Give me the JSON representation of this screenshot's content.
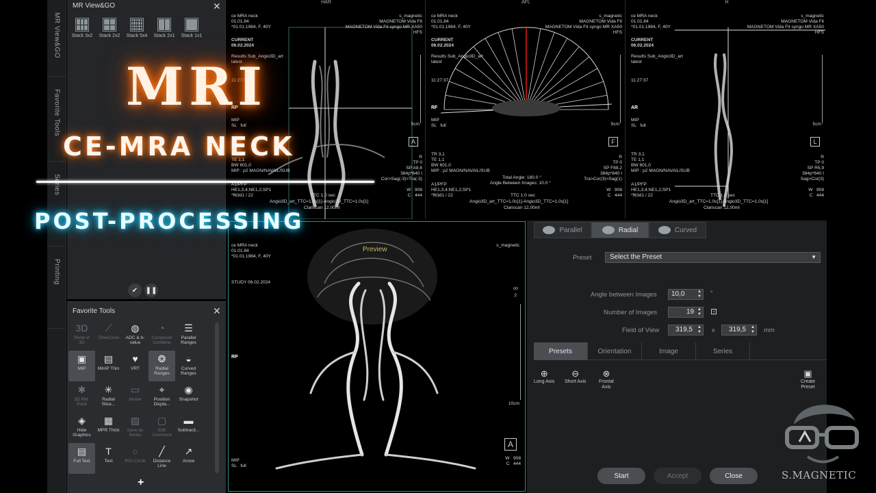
{
  "side_tabs": [
    "MR View&GO",
    "Favorite Tools",
    "Series",
    "Printing"
  ],
  "mr_panel": {
    "title": "MR View&GO",
    "stacks": [
      {
        "label": "Stack 3x2",
        "cols": 3,
        "rows": 2
      },
      {
        "label": "Stack 2x2",
        "cols": 2,
        "rows": 2
      },
      {
        "label": "Stack 5x4",
        "cols": 5,
        "rows": 4
      },
      {
        "label": "Stack 2x1",
        "cols": 2,
        "rows": 1
      },
      {
        "label": "Stack 1x1",
        "cols": 1,
        "rows": 1
      }
    ]
  },
  "favorites": {
    "title": "Favorite Tools",
    "tools": [
      {
        "label": "Show in\n3D",
        "icon": "3D",
        "dim": true
      },
      {
        "label": "TimeCurve",
        "icon": "⟋",
        "dim": true
      },
      {
        "label": "ADC & b-\nvalue",
        "icon": "◍",
        "dim": false
      },
      {
        "label": "Composer\nCombine",
        "icon": "◔",
        "dim": true
      },
      {
        "label": "Parallel\nRanges",
        "icon": "☰",
        "dim": false
      },
      {
        "label": "MIP",
        "icon": "▣",
        "dim": false,
        "selected": true
      },
      {
        "label": "MinIP Thin",
        "icon": "▤",
        "dim": false
      },
      {
        "label": "VRT",
        "icon": "♥",
        "dim": false
      },
      {
        "label": "Radial\nRanges",
        "icon": "❂",
        "dim": false,
        "selected": true
      },
      {
        "label": "Curved\nRanges",
        "icon": "◒",
        "dim": false
      },
      {
        "label": "3D Ref.\nPoint",
        "icon": "✱",
        "dim": true
      },
      {
        "label": "Radial\nSlice...",
        "icon": "✳",
        "dim": false
      },
      {
        "label": "Movie",
        "icon": "▭",
        "dim": true
      },
      {
        "label": "Position\nDispla...",
        "icon": "⌖",
        "dim": false
      },
      {
        "label": "Snapshot",
        "icon": "◉",
        "dim": false
      },
      {
        "label": "Hide\nGraphics",
        "icon": "◈",
        "dim": false
      },
      {
        "label": "MPR Thick",
        "icon": "▦",
        "dim": false
      },
      {
        "label": "Save as\nSeries",
        "icon": "▧",
        "dim": true
      },
      {
        "label": "Edit\nComment",
        "icon": "▢",
        "dim": true
      },
      {
        "label": "Subtracti...",
        "icon": "▬",
        "dim": false
      },
      {
        "label": "Full Text",
        "icon": "▤",
        "dim": false,
        "selected": true
      },
      {
        "label": "Text",
        "icon": "T",
        "dim": false
      },
      {
        "label": "ROI Circle",
        "icon": "○",
        "dim": true
      },
      {
        "label": "Distance\nLine",
        "icon": "╱",
        "dim": false
      },
      {
        "label": "Arrow",
        "icon": "↗",
        "dim": false
      }
    ]
  },
  "viewports": {
    "har": {
      "header": "HAR",
      "name": "ce MRA neck",
      "date": "01.01.84",
      "patient": "*01.01.1984, F, 40Y",
      "study_label": "CURRENT",
      "study_date": "06.02.2024",
      "result": "Results Sub_Angio3D_art",
      "latest": "latest",
      "time": "11:27:37",
      "orient_left": "RP",
      "mip": "MIP",
      "sl": "SL",
      "sl_val": "full",
      "tr": "TR 3,1",
      "te": "TE 1,1",
      "bw": "BW 601,0",
      "mip2": "MIP : p2 MAGN/NAVAIL/SUB",
      "a1": "A1/PFP",
      "he": "HE1,3,4;NE1,2;SP1",
      "fov": "*f63d1 / 22",
      "site": "s_magnetic",
      "scanner1": "MAGNETOM Vida Fit",
      "scanner2": "MAGNETOM Vida Fit syngo MR XA50",
      "hfs": "HFS",
      "scale": "5cm",
      "r": "R",
      "tp": "TP 0",
      "sp": "SP A8,6",
      "matrix": "384p*640 I",
      "cor": "Cor>Sag(-3)>Tra(-3)",
      "w": "W",
      "wval": "908",
      "c": "C",
      "cval": "444",
      "ttc": "TTC 1.0 sec",
      "angio": "Angio3D_art_TTC=1.0s[1]-Angio3D_TTC=1.0s[1]",
      "clari": "Clariscan 12,00ml",
      "box": "A"
    },
    "afl": {
      "header": "AFL",
      "name": "ce MRA neck",
      "date": "01.01.84",
      "patient": "*01.01.1984, F, 40Y",
      "study_label": "CURRENT",
      "study_date": "06.02.2024",
      "result": "Results Sub_Angio3D_art",
      "latest": "latest",
      "time": "11:27:37",
      "orient_left": "RF",
      "mip": "MIP",
      "sl": "SL",
      "sl_val": "full",
      "tr": "TR 3,1",
      "te": "TE 1,1",
      "bw": "BW 601,0",
      "mip2": "MIP : p2 MAGN/NAVAIL/SUB",
      "a1": "A1/PFP",
      "he": "HE1,3,4;NE1,2;SP1",
      "fov": "*f63d1 / 22",
      "site": "s_magnetic",
      "scanner1": "MAGNETOM Vida Fit",
      "scanner2": "MAGNETOM Vida Fit syngo MR XA50",
      "hfs": "HFS",
      "scale": "5cm",
      "r": "R",
      "tp": "TP 0",
      "sp": "SP F88,2",
      "matrix": "384p*640 I",
      "cor": "Tra>Cor(3)>Sag(1)",
      "w": "W",
      "wval": "908",
      "c": "C",
      "cval": "444",
      "ttc": "TTC 1.0 sec",
      "angio": "Angio3D_art_TTC=1.0s[1]-Angio3D_TTC=1.0s[1]",
      "clari": "Clariscan 12,00ml",
      "total_angle": "Total Angle: 180.0 °",
      "between": "Angle Between Images: 10.0 °",
      "box": "F"
    },
    "h": {
      "header": "H",
      "name": "ce MRA neck",
      "date": "01.01.84",
      "patient": "*01.01.1984, F, 40Y",
      "study_label": "CURRENT",
      "study_date": "06.02.2024",
      "result": "Results Sub_Angio3D_art",
      "latest": "latest",
      "time": "11:27:37",
      "orient_left": "AR",
      "mip": "MIP",
      "sl": "SL",
      "sl_val": "full",
      "tr": "TR 3,1",
      "te": "TE 1,1",
      "bw": "BW 601,0",
      "mip2": "MIP : p2 MAGN/NAVAIL/SUB",
      "a1": "A1/PFP",
      "he": "HE1,3,4;NE1,2;SP1",
      "fov": "*f63d1 / 22",
      "site": "s_magnetic",
      "scanner1": "MAGNETOM Vida Fit",
      "scanner2": "MAGNETOM Vida Fit syngo MR XA50",
      "hfs": "HFS",
      "scale": "5cm",
      "r": "R",
      "tp": "TP 0",
      "sp": "SP R5,9",
      "matrix": "384p*640 I",
      "cor": "Sag>Cor(3)",
      "w": "W",
      "wval": "908",
      "c": "C",
      "cval": "444",
      "ttc": "TTC 1.0 sec",
      "angio": "Angio3D_art_TTC=1.0s[1]-Angio3D_TTC=1.0s[1]",
      "clari": "Clariscan 12,00ml",
      "box": "L"
    },
    "preview": {
      "name": "ce MRA neck",
      "date": "01.01.84",
      "patient": "*01.01.1984, F, 40Y",
      "study": "STUDY 06.02.2024",
      "site": "s_magnetic",
      "label": "Preview",
      "orient_left": "RP",
      "scale": "10cm",
      "mip": "MIP",
      "sl": "SL",
      "sl_val": "full",
      "w": "W",
      "wval": "908",
      "c": "C",
      "cval": "444",
      "box": "A",
      "num": "2"
    }
  },
  "protocol": {
    "tabs": [
      "Parallel",
      "Radial",
      "Curved"
    ],
    "active_tab": 1,
    "preset_label": "Preset",
    "preset_value": "Select the Preset",
    "angle_label": "Angle between Images",
    "angle_value": "10,0",
    "angle_unit": "°",
    "number_label": "Number of Images",
    "number_value": "19",
    "fov_label": "Field of View",
    "fov_w": "319,5",
    "fov_x": "x",
    "fov_h": "319,5",
    "fov_unit": "mm",
    "subtabs": [
      "Presets",
      "Orientation",
      "Image",
      "Series"
    ],
    "presets": [
      {
        "label": "Long Axis",
        "icon": "⊕"
      },
      {
        "label": "Short Axis",
        "icon": "⊖"
      },
      {
        "label": "Frontal\nAxis",
        "icon": "⊗"
      }
    ],
    "create_preset": "Create\nPreset",
    "start": "Start",
    "accept": "Accept",
    "close": "Close"
  },
  "title_overlay": {
    "line1": "MRI",
    "line2": "CE-MRA NECK",
    "line3": "POST-PROCESSING"
  },
  "logo_text": "S.MAGNETIC"
}
